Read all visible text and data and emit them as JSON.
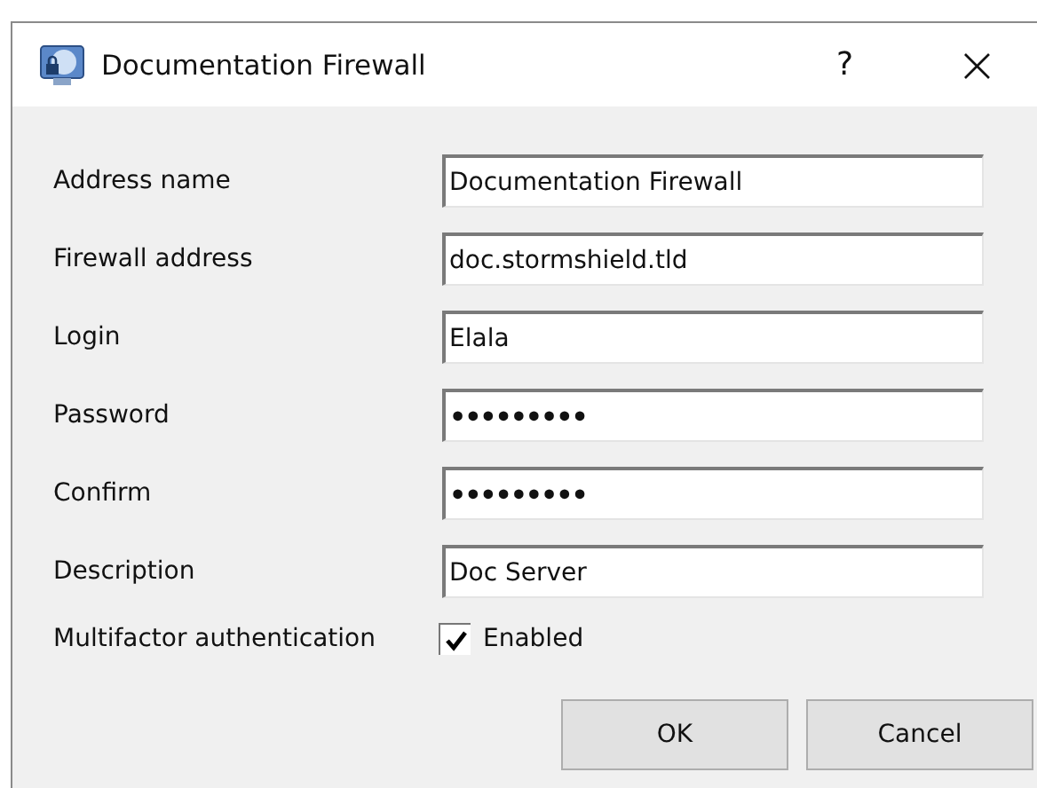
{
  "window": {
    "title": "Documentation Firewall",
    "help": "?",
    "close": "×"
  },
  "fields": [
    {
      "label": "Address name",
      "value": "Documentation Firewall"
    },
    {
      "label": "Firewall address",
      "value": "doc.stormshield.tld"
    },
    {
      "label": "Login",
      "value": "Elala"
    },
    {
      "label": "Password",
      "value": "•••••••••"
    },
    {
      "label": "Confirm",
      "value": "•••••••••"
    },
    {
      "label": "Description",
      "value": "Doc Server"
    }
  ],
  "mfa": {
    "label": "Multifactor authentication",
    "checkbox_label": "Enabled",
    "checked": true
  },
  "buttons": [
    "OK",
    "Cancel"
  ]
}
